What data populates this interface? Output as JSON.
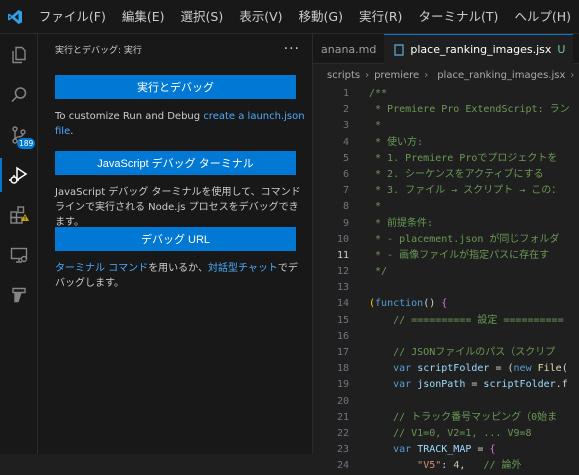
{
  "app": {
    "logo": "vscode-logo-icon",
    "accent": "#0078d4"
  },
  "menu": [
    "ファイル(F)",
    "編集(E)",
    "選択(S)",
    "表示(V)",
    "移動(G)",
    "実行(R)",
    "ターミナル(T)",
    "ヘルプ(H)"
  ],
  "activity": {
    "scm_badge": "189"
  },
  "sidebar": {
    "title": "実行とデバッグ: 実行",
    "more": "···",
    "run_button": "実行とデバッグ",
    "customize_text": "To customize Run and Debug ",
    "customize_link": "create a launch.json file",
    "customize_end": ".",
    "terminal_button": "JavaScript デバッグ ターミナル",
    "terminal_text": "JavaScript デバッグ ターミナルを使用して、コマンド ラインで実行される Node.js プロセスをデバッグできます。",
    "url_button": "デバッグ URL",
    "footer_link1": "ターミナル コマンド",
    "footer_text1": "を用いるか、",
    "footer_link2": "対話型チャット",
    "footer_text2": "でデバッグします。"
  },
  "editor": {
    "tabs": [
      {
        "label": "anana.md"
      },
      {
        "label": "place_ranking_images.jsx",
        "status": "U"
      }
    ],
    "breadcrumb": [
      "scripts",
      "premiere",
      "place_ranking_images.jsx",
      "/"
    ],
    "current_line": 11,
    "lines": [
      {
        "n": "1",
        "t": "/**"
      },
      {
        "n": "2",
        "t": " * Premiere Pro ExtendScript: ラン"
      },
      {
        "n": "3",
        "t": " *"
      },
      {
        "n": "4",
        "t": " * 使い方:"
      },
      {
        "n": "5",
        "t": " * 1. Premiere Proでプロジェクトを"
      },
      {
        "n": "6",
        "t": " * 2. シーケンスをアクティブにする"
      },
      {
        "n": "7",
        "t": " * 3. ファイル → スクリプト → この："
      },
      {
        "n": "8",
        "t": " *"
      },
      {
        "n": "9",
        "t": " * 前提条件:"
      },
      {
        "n": "10",
        "t": " * - placement.json が同じフォルダ"
      },
      {
        "n": "11",
        "t": " * - 画像ファイルが指定パスに存在す"
      },
      {
        "n": "12",
        "t": " */"
      },
      {
        "n": "13",
        "t": ""
      },
      {
        "n": "14",
        "t": "(function() {"
      },
      {
        "n": "15",
        "t": "    // ========== 設定 =========="
      },
      {
        "n": "16",
        "t": ""
      },
      {
        "n": "17",
        "t": "    // JSONファイルのパス（スクリプ"
      },
      {
        "n": "18",
        "t": "    var scriptFolder = (new File("
      },
      {
        "n": "19",
        "t": "    var jsonPath = scriptFolder.f"
      },
      {
        "n": "20",
        "t": ""
      },
      {
        "n": "21",
        "t": "    // トラック番号マッピング（0始ま"
      },
      {
        "n": "22",
        "t": "    // V1=0, V2=1, ... V9=8"
      },
      {
        "n": "23",
        "t": "    var TRACK_MAP = {"
      },
      {
        "n": "24",
        "t": "        \"V5\": 4,   // 論外"
      }
    ]
  }
}
